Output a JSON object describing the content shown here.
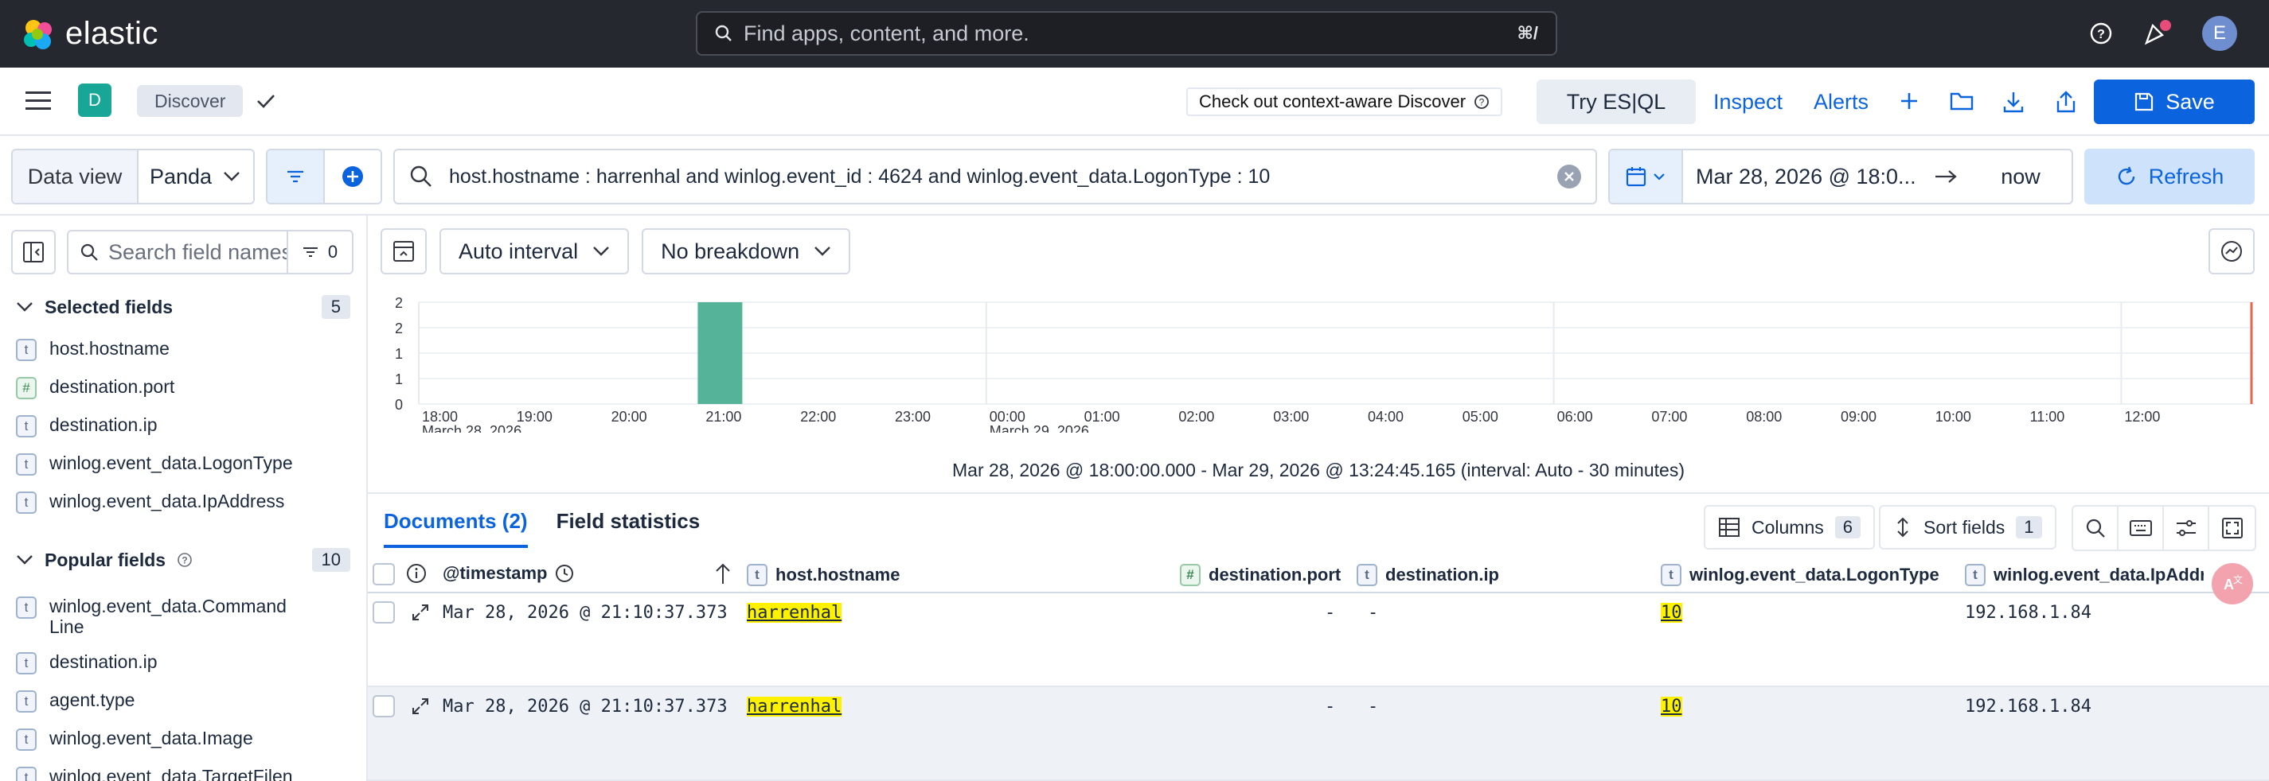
{
  "topbar": {
    "brand": "elastic",
    "search_placeholder": "Find apps, content, and more.",
    "search_shortcut": "⌘/",
    "avatar_initial": "E"
  },
  "navbar": {
    "space_initial": "D",
    "breadcrumb": "Discover",
    "context_pill": "Check out context-aware Discover",
    "try_esql": "Try ES|QL",
    "inspect": "Inspect",
    "alerts": "Alerts",
    "save": "Save"
  },
  "querybar": {
    "dataview_label": "Data view",
    "dataview_value": "Panda",
    "query": "host.hostname : harrenhal and winlog.event_id : 4624  and winlog.event_data.LogonType : 10",
    "date_start": "Mar 28, 2026 @ 18:0...",
    "date_end": "now",
    "refresh": "Refresh"
  },
  "sidebar": {
    "search_placeholder": "Search field names",
    "filter_count": "0",
    "selected_label": "Selected fields",
    "selected_count": "5",
    "selected_fields": [
      {
        "type": "t",
        "name": "host.hostname"
      },
      {
        "type": "#",
        "name": "destination.port"
      },
      {
        "type": "t",
        "name": "destination.ip"
      },
      {
        "type": "t",
        "name": "winlog.event_data.LogonType"
      },
      {
        "type": "t",
        "name": "winlog.event_data.IpAddress"
      }
    ],
    "popular_label": "Popular fields",
    "popular_count": "10",
    "popular_fields": [
      {
        "type": "t",
        "name": "winlog.event_data.Command\nLine"
      },
      {
        "type": "t",
        "name": "destination.ip"
      },
      {
        "type": "t",
        "name": "agent.type"
      },
      {
        "type": "t",
        "name": "winlog.event_data.Image"
      },
      {
        "type": "t",
        "name": "winlog.event_data.TargetFilen"
      }
    ]
  },
  "histogram": {
    "interval": "Auto interval",
    "breakdown": "No breakdown",
    "range_text": "Mar 28, 2026 @ 18:00:00.000 - Mar 29, 2026 @ 13:24:45.165 (interval: Auto - 30 minutes)"
  },
  "chart_data": {
    "type": "bar",
    "y_ticks": [
      "2",
      "2",
      "1",
      "1",
      "0"
    ],
    "ylim": [
      0,
      2
    ],
    "x_ticks": [
      "18:00",
      "19:00",
      "20:00",
      "21:00",
      "22:00",
      "23:00",
      "00:00",
      "01:00",
      "02:00",
      "03:00",
      "04:00",
      "05:00",
      "06:00",
      "07:00",
      "08:00",
      "09:00",
      "10:00",
      "11:00",
      "12:00"
    ],
    "x_subticks": [
      {
        "under": "18:00",
        "text": "March 28, 2026"
      },
      {
        "under": "00:00",
        "text": "March 29, 2026"
      }
    ],
    "bars": [
      {
        "start": "21:00",
        "end": "21:30",
        "value": 2
      }
    ],
    "bar_color": "#54b399",
    "now_marker_color": "#e7664c"
  },
  "documents": {
    "tab_documents": "Documents (2)",
    "tab_stats": "Field statistics",
    "columns_label": "Columns",
    "columns_count": "6",
    "sort_label": "Sort fields",
    "sort_count": "1",
    "headers": [
      {
        "type": "",
        "name": "@timestamp"
      },
      {
        "type": "t",
        "name": "host.hostname"
      },
      {
        "type": "#",
        "name": "destination.port"
      },
      {
        "type": "t",
        "name": "destination.ip"
      },
      {
        "type": "t",
        "name": "winlog.event_data.LogonType"
      },
      {
        "type": "t",
        "name": "winlog.event_data.IpAddress"
      }
    ],
    "rows": [
      {
        "timestamp": "Mar 28, 2026 @ 21:10:37.373",
        "hostname": "harrenhal",
        "port": "-",
        "ip": "-",
        "logon_type": "10",
        "ip_address": "192.168.1.84"
      },
      {
        "timestamp": "Mar 28, 2026 @ 21:10:37.373",
        "hostname": "harrenhal",
        "port": "-",
        "ip": "-",
        "logon_type": "10",
        "ip_address": "192.168.1.84"
      }
    ]
  }
}
